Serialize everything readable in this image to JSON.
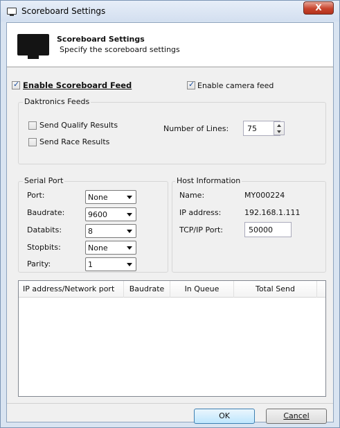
{
  "window": {
    "title": "Scoreboard Settings",
    "close_glyph": "X"
  },
  "header": {
    "title": "Scoreboard Settings",
    "subtitle": "Specify the scoreboard settings",
    "icon": "monitor-icon"
  },
  "feeds": {
    "enable_scoreboard_label": "Enable Scoreboard Feed",
    "enable_scoreboard_checked": true,
    "enable_camera_label": "Enable camera feed",
    "enable_camera_checked": true
  },
  "daktronics": {
    "group_label": "Daktronics Feeds",
    "send_qualify_label": "Send Qualify Results",
    "send_qualify_checked": false,
    "send_race_label": "Send Race Results",
    "send_race_checked": false,
    "lines_label": "Number of Lines:",
    "lines_value": "75"
  },
  "serial": {
    "group_label": "Serial Port",
    "fields": [
      {
        "label": "Port:",
        "value": "None"
      },
      {
        "label": "Baudrate:",
        "value": "9600"
      },
      {
        "label": "Databits:",
        "value": "8"
      },
      {
        "label": "Stopbits:",
        "value": "None"
      },
      {
        "label": "Parity:",
        "value": "1"
      }
    ]
  },
  "host": {
    "group_label": "Host Information",
    "name_label": "Name:",
    "name_value": "MY000224",
    "ip_label": "IP address:",
    "ip_value": "192.168.1.111",
    "port_label": "TCP/IP Port:",
    "port_value": "50000"
  },
  "table": {
    "columns": [
      "IP address/Network port",
      "Baudrate",
      "In Queue",
      "Total Send"
    ],
    "rows": []
  },
  "buttons": {
    "ok": "OK",
    "cancel": "Cancel"
  }
}
